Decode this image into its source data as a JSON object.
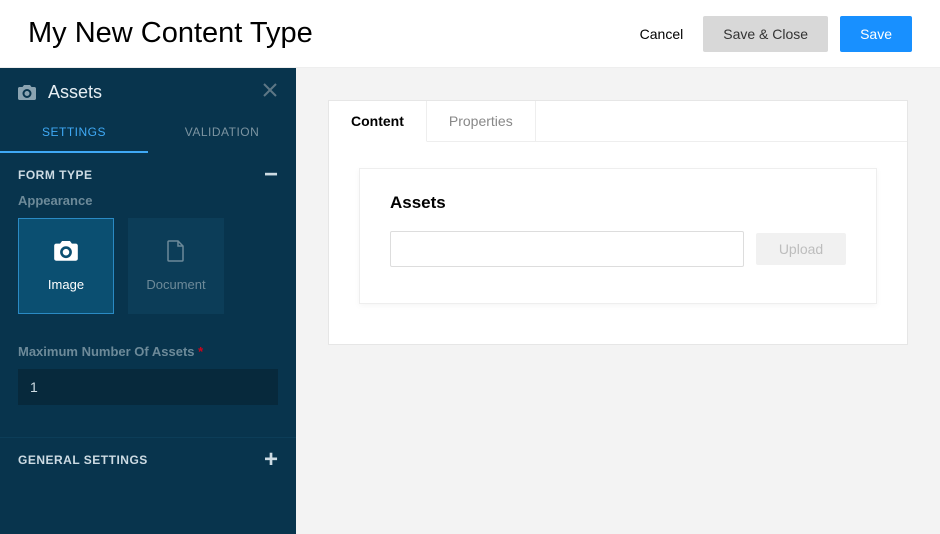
{
  "header": {
    "title": "My New Content Type",
    "cancel_label": "Cancel",
    "save_close_label": "Save & Close",
    "save_label": "Save"
  },
  "sidebar": {
    "panel_title": "Assets",
    "tabs": [
      {
        "label": "SETTINGS"
      },
      {
        "label": "VALIDATION"
      }
    ],
    "form_type": {
      "title": "FORM TYPE",
      "appearance_label": "Appearance",
      "options": [
        {
          "label": "Image"
        },
        {
          "label": "Document"
        }
      ],
      "max_label": "Maximum Number Of Assets",
      "max_value": "1"
    },
    "general_settings": {
      "title": "GENERAL SETTINGS"
    }
  },
  "main": {
    "tabs": [
      {
        "label": "Content"
      },
      {
        "label": "Properties"
      }
    ],
    "form_title": "Assets",
    "upload_label": "Upload"
  }
}
